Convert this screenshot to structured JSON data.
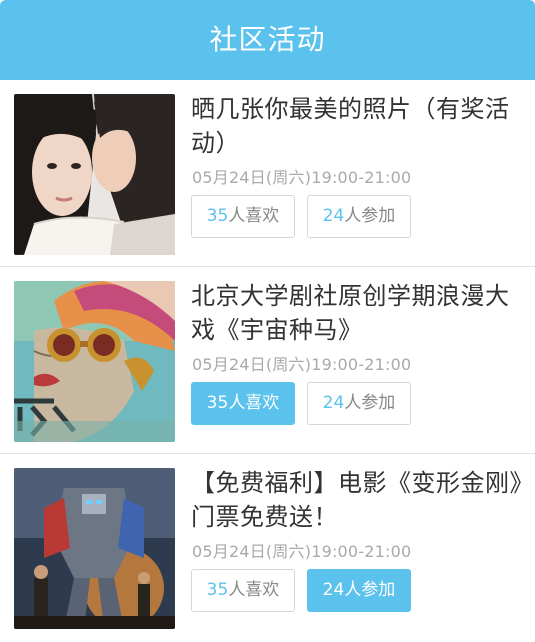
{
  "header": {
    "title": "社区活动"
  },
  "activities": [
    {
      "title": "晒几张你最美的照片（有奖活动）",
      "time": "05月24日(周六)19:00-21:00",
      "like_count": "35",
      "like_suffix": "人喜欢",
      "like_active": false,
      "join_count": "24",
      "join_suffix": "人参加",
      "join_active": false,
      "image": "photo-two-girls"
    },
    {
      "title": "北京大学剧社原创学期浪漫大戏《宇宙种马》",
      "time": "05月24日(周六)19:00-21:00",
      "like_count": "35",
      "like_suffix": "人喜欢",
      "like_active": true,
      "join_count": "24",
      "join_suffix": "人参加",
      "join_active": false,
      "image": "illustrated-poster-goggles"
    },
    {
      "title": "【免费福利】电影《变形金刚》门票免费送！",
      "time": "05月24日(周六)19:00-21:00",
      "like_count": "35",
      "like_suffix": "人喜欢",
      "like_active": false,
      "join_count": "24",
      "join_suffix": "人参加",
      "join_active": true,
      "image": "movie-robot-poster"
    }
  ],
  "colors": {
    "accent": "#5bc1ed",
    "text": "#333333",
    "muted": "#a9a9a9"
  }
}
